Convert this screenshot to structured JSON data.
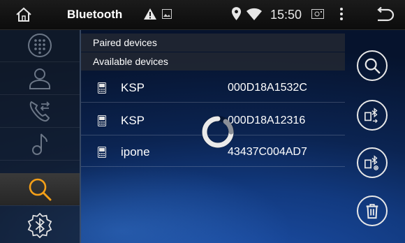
{
  "topbar": {
    "title": "Bluetooth",
    "time": "15:50"
  },
  "sidebar": {
    "items": [
      {
        "icon": "dialpad-icon",
        "active": false
      },
      {
        "icon": "contacts-icon",
        "active": false
      },
      {
        "icon": "call-log-icon",
        "active": false
      },
      {
        "icon": "music-note-icon",
        "active": false
      },
      {
        "icon": "search-icon",
        "active": true
      },
      {
        "icon": "bluetooth-settings-icon",
        "active": false
      }
    ]
  },
  "list": {
    "paired_header": "Paired devices",
    "available_header": "Available devices",
    "devices": [
      {
        "name": "KSP",
        "address": "000D18A1532C"
      },
      {
        "name": "KSP",
        "address": "000D18A12316"
      },
      {
        "name": "ipone",
        "address": "43437C004AD7"
      }
    ]
  },
  "actions": {
    "search": "search-icon",
    "connect": "phone-bluetooth-connect-icon",
    "disconnect": "phone-bluetooth-disconnect-icon",
    "delete": "trash-icon"
  },
  "colors": {
    "accent_orange": "#f5a018",
    "icon_grey": "#6b7686",
    "text": "#ffffff"
  }
}
